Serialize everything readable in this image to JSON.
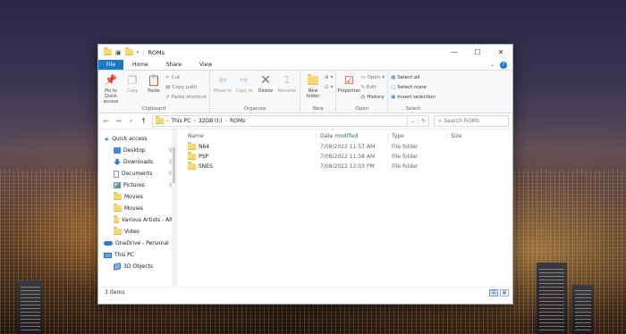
{
  "window": {
    "title": "ROMs",
    "controls": {
      "minimize": "—",
      "maximize": "☐",
      "close": "✕"
    }
  },
  "ribbon_tabs": [
    {
      "label": "File"
    },
    {
      "label": "Home"
    },
    {
      "label": "Share"
    },
    {
      "label": "View"
    }
  ],
  "ribbon": {
    "clipboard": {
      "label": "Clipboard",
      "pin": "Pin to Quick access",
      "copy": "Copy",
      "paste": "Paste",
      "cut": "Cut",
      "copy_path": "Copy path",
      "paste_shortcut": "Paste shortcut"
    },
    "organize": {
      "label": "Organize",
      "move_to": "Move to",
      "copy_to": "Copy to",
      "delete": "Delete",
      "rename": "Rename"
    },
    "new": {
      "label": "New",
      "new_folder": "New folder"
    },
    "open": {
      "label": "Open",
      "properties": "Properties",
      "open": "Open",
      "edit": "Edit",
      "history": "History"
    },
    "select": {
      "label": "Select",
      "select_all": "Select all",
      "select_none": "Select none",
      "invert": "Invert selection"
    }
  },
  "address": {
    "crumbs": [
      "This PC",
      "32GB (I:)",
      "ROMs"
    ],
    "search_placeholder": "Search ROMs"
  },
  "nav": [
    {
      "label": "Quick access",
      "kind": "section",
      "icon": "star-icon"
    },
    {
      "label": "Desktop",
      "kind": "child",
      "icon": "desktop-icon",
      "pinned": true
    },
    {
      "label": "Downloads",
      "kind": "child",
      "icon": "download-icon",
      "pinned": true
    },
    {
      "label": "Documents",
      "kind": "child",
      "icon": "documents-icon",
      "pinned": true
    },
    {
      "label": "Pictures",
      "kind": "child",
      "icon": "pictures-icon",
      "pinned": true
    },
    {
      "label": "Movies",
      "kind": "child",
      "icon": "folder-icon"
    },
    {
      "label": "Movies",
      "kind": "child",
      "icon": "folder-icon"
    },
    {
      "label": "Various Artists - Alte",
      "kind": "child",
      "icon": "folder-icon"
    },
    {
      "label": "Video",
      "kind": "child",
      "icon": "folder-icon"
    },
    {
      "label": "OneDrive - Personal",
      "kind": "section",
      "icon": "onedrive-icon"
    },
    {
      "label": "This PC",
      "kind": "section",
      "icon": "pc-icon"
    },
    {
      "label": "3D Objects",
      "kind": "child",
      "icon": "3d-objects-icon"
    }
  ],
  "columns": {
    "name": "Name",
    "date": "Date modified",
    "type": "Type",
    "size": "Size"
  },
  "files": [
    {
      "name": "N64",
      "date": "7/08/2022 11:57 AM",
      "type": "File folder"
    },
    {
      "name": "PSP",
      "date": "7/08/2022 11:58 AM",
      "type": "File folder"
    },
    {
      "name": "SNES",
      "date": "7/08/2022 12:03 PM",
      "type": "File folder"
    }
  ],
  "status": {
    "items": "3 items"
  },
  "colors": {
    "accent": "#1979ca",
    "folder": "#f8d775"
  }
}
